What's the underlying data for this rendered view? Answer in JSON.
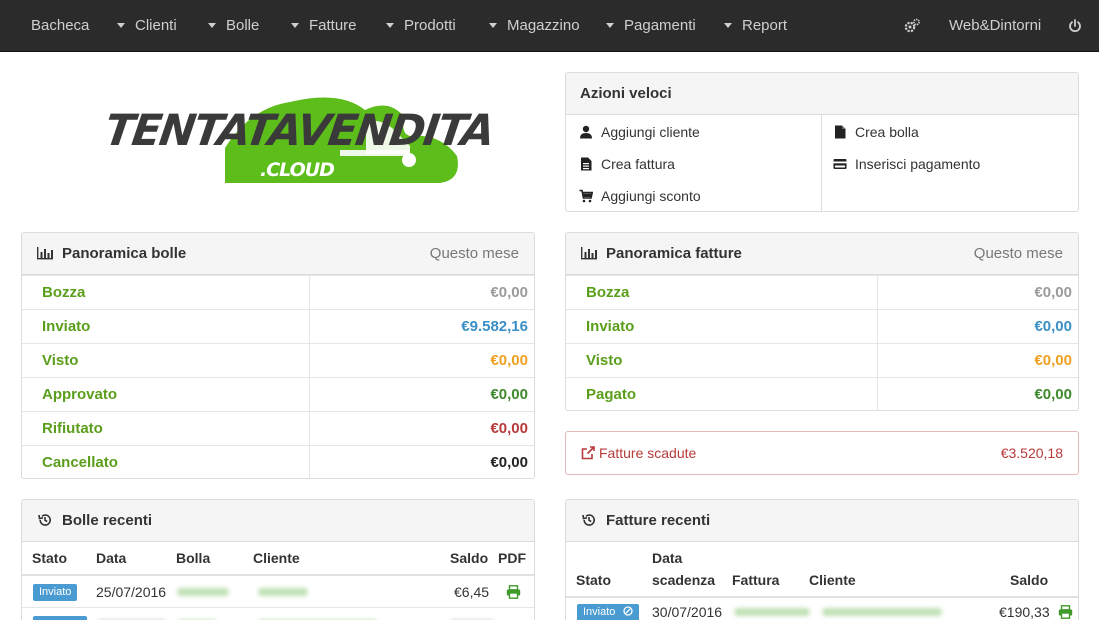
{
  "nav": {
    "items": [
      {
        "label": "Bacheca",
        "has_caret": false
      },
      {
        "label": "Clienti",
        "has_caret": true
      },
      {
        "label": "Bolle",
        "has_caret": true
      },
      {
        "label": "Fatture",
        "has_caret": true
      },
      {
        "label": "Prodotti",
        "has_caret": true
      },
      {
        "label": "Magazzino",
        "has_caret": true
      },
      {
        "label": "Pagamenti",
        "has_caret": true
      },
      {
        "label": "Report",
        "has_caret": true
      }
    ],
    "company": "Web&Dintorni",
    "settings_icon": "cogs-icon",
    "power_icon": "power-icon"
  },
  "logo": {
    "line1": "TENTATAVENDITA",
    "line2": ".CLOUD",
    "color_green": "#5cbd1b",
    "color_dark": "#3a3a3a"
  },
  "quick_actions": {
    "title": "Azioni veloci",
    "left": [
      {
        "label": "Aggiungi cliente",
        "icon": "user-icon"
      },
      {
        "label": "Crea fattura",
        "icon": "file-icon"
      },
      {
        "label": "Aggiungi sconto",
        "icon": "cart-icon"
      }
    ],
    "right": [
      {
        "label": "Crea bolla",
        "icon": "file-icon"
      },
      {
        "label": "Inserisci pagamento",
        "icon": "credit-card-icon"
      }
    ]
  },
  "bolle_overview": {
    "title": "Panoramica bolle",
    "period": "Questo mese",
    "rows": [
      {
        "label": "Bozza",
        "value": "€0,00",
        "color": "#9a9a9a"
      },
      {
        "label": "Inviato",
        "value": "€9.582,16",
        "color": "#3a8fc7"
      },
      {
        "label": "Visto",
        "value": "€0,00",
        "color": "#f0a020"
      },
      {
        "label": "Approvato",
        "value": "€0,00",
        "color": "#3f8a2a"
      },
      {
        "label": "Rifiutato",
        "value": "€0,00",
        "color": "#b83a3a"
      },
      {
        "label": "Cancellato",
        "value": "€0,00",
        "color": "#222222"
      }
    ]
  },
  "fatture_overview": {
    "title": "Panoramica fatture",
    "period": "Questo mese",
    "rows": [
      {
        "label": "Bozza",
        "value": "€0,00",
        "color": "#9a9a9a"
      },
      {
        "label": "Inviato",
        "value": "€0,00",
        "color": "#3a8fc7"
      },
      {
        "label": "Visto",
        "value": "€0,00",
        "color": "#f0a020"
      },
      {
        "label": "Pagato",
        "value": "€0,00",
        "color": "#3f8a2a"
      }
    ]
  },
  "overdue": {
    "label": "Fatture scadute",
    "value": "€3.520,18",
    "color": "#b83a3a"
  },
  "bolle_recenti": {
    "title": "Bolle recenti",
    "headers": {
      "stato": "Stato",
      "data": "Data",
      "bolla": "Bolla",
      "cliente": "Cliente",
      "saldo": "Saldo",
      "pdf": "PDF"
    },
    "rows": [
      {
        "stato": "Inviato",
        "data": "25/07/2016",
        "saldo": "€6,45"
      }
    ]
  },
  "fatture_recenti": {
    "title": "Fatture recenti",
    "headers": {
      "stato": "Stato",
      "data_line1": "Data",
      "data_line2": "scadenza",
      "fattura": "Fattura",
      "cliente": "Cliente",
      "saldo": "Saldo"
    },
    "rows": [
      {
        "stato": "Inviato",
        "data": "30/07/2016",
        "saldo": "€190,33"
      }
    ]
  }
}
